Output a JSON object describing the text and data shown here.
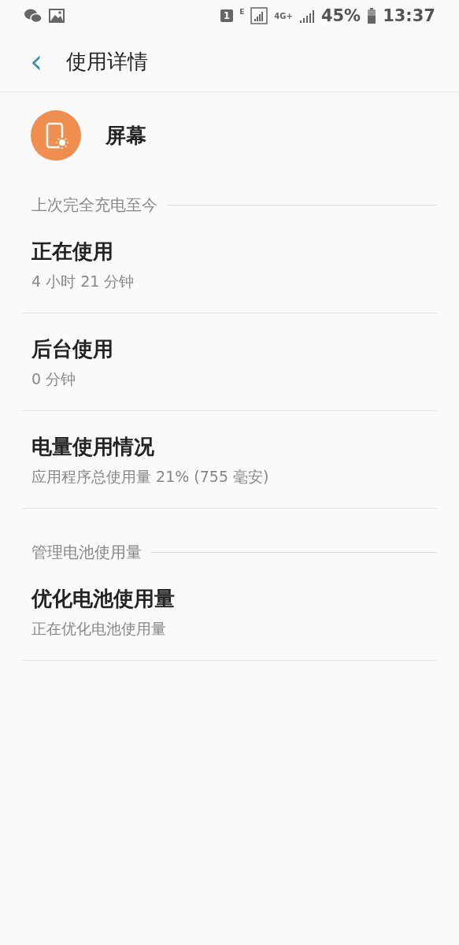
{
  "status_bar": {
    "sim": "1",
    "network": "E",
    "lte": "4G+",
    "battery": "45%",
    "time": "13:37"
  },
  "header": {
    "back": "‹",
    "title": "使用详情"
  },
  "app": {
    "name": "屏幕"
  },
  "sections": [
    {
      "header": "上次完全充电至今",
      "items": [
        {
          "title": "正在使用",
          "subtitle": "4 小时 21 分钟"
        },
        {
          "title": "后台使用",
          "subtitle": "0 分钟"
        },
        {
          "title": "电量使用情况",
          "subtitle": "应用程序总使用量 21% (755 毫安)"
        }
      ]
    },
    {
      "header": "管理电池使用量",
      "items": [
        {
          "title": "优化电池使用量",
          "subtitle": "正在优化电池使用量"
        }
      ]
    }
  ]
}
